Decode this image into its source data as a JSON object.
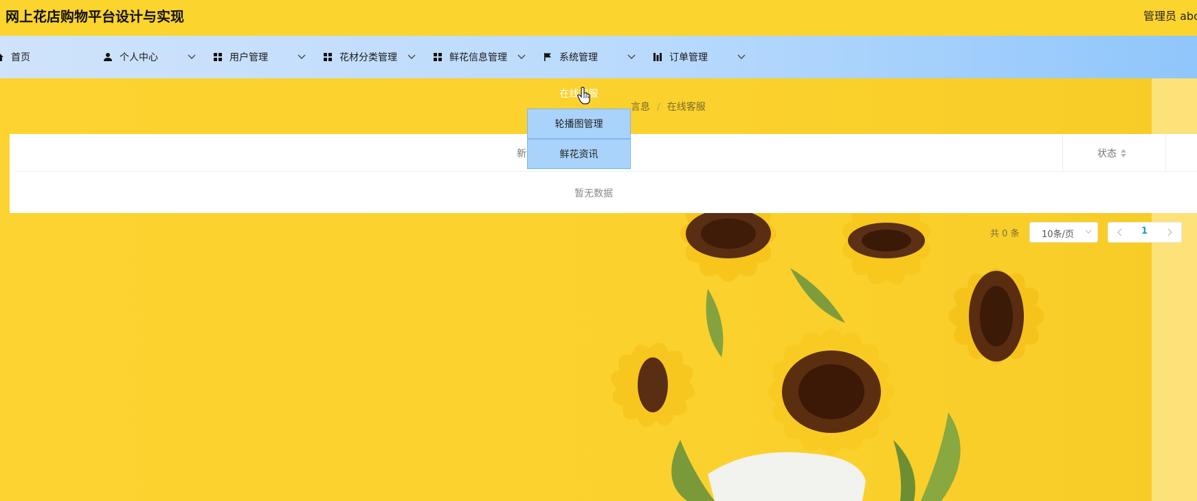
{
  "app": {
    "title": "网上花店购物平台设计与实现",
    "user": "管理员 abc"
  },
  "nav": {
    "items": [
      {
        "label": "首页",
        "icon": "home-icon"
      },
      {
        "label": "个人中心",
        "icon": "user-icon"
      },
      {
        "label": "用户管理",
        "icon": "grid-icon"
      },
      {
        "label": "花材分类管理",
        "icon": "grid-icon"
      },
      {
        "label": "鲜花信息管理",
        "icon": "grid-icon"
      },
      {
        "label": "系统管理",
        "icon": "flag-icon"
      },
      {
        "label": "订单管理",
        "icon": "chart-icon"
      }
    ]
  },
  "dropdown": {
    "items": [
      "在线客服",
      "轮播图管理",
      "鲜花资讯"
    ]
  },
  "breadcrumb": {
    "parent": "言息",
    "current": "在线客服"
  },
  "table": {
    "columns": [
      "新消",
      "状态"
    ],
    "empty_text": "暂无数据"
  },
  "pagination": {
    "total": "共 0 条",
    "page_size": "10条/页",
    "current_page": "1"
  },
  "colors": {
    "header_bg": "#fcd42e",
    "nav_bg_start": "#cfe3fb",
    "nav_bg_end": "#8fc6fb",
    "dropdown_bg": "#a9d3fb",
    "page_number": "#1aa0b4"
  }
}
